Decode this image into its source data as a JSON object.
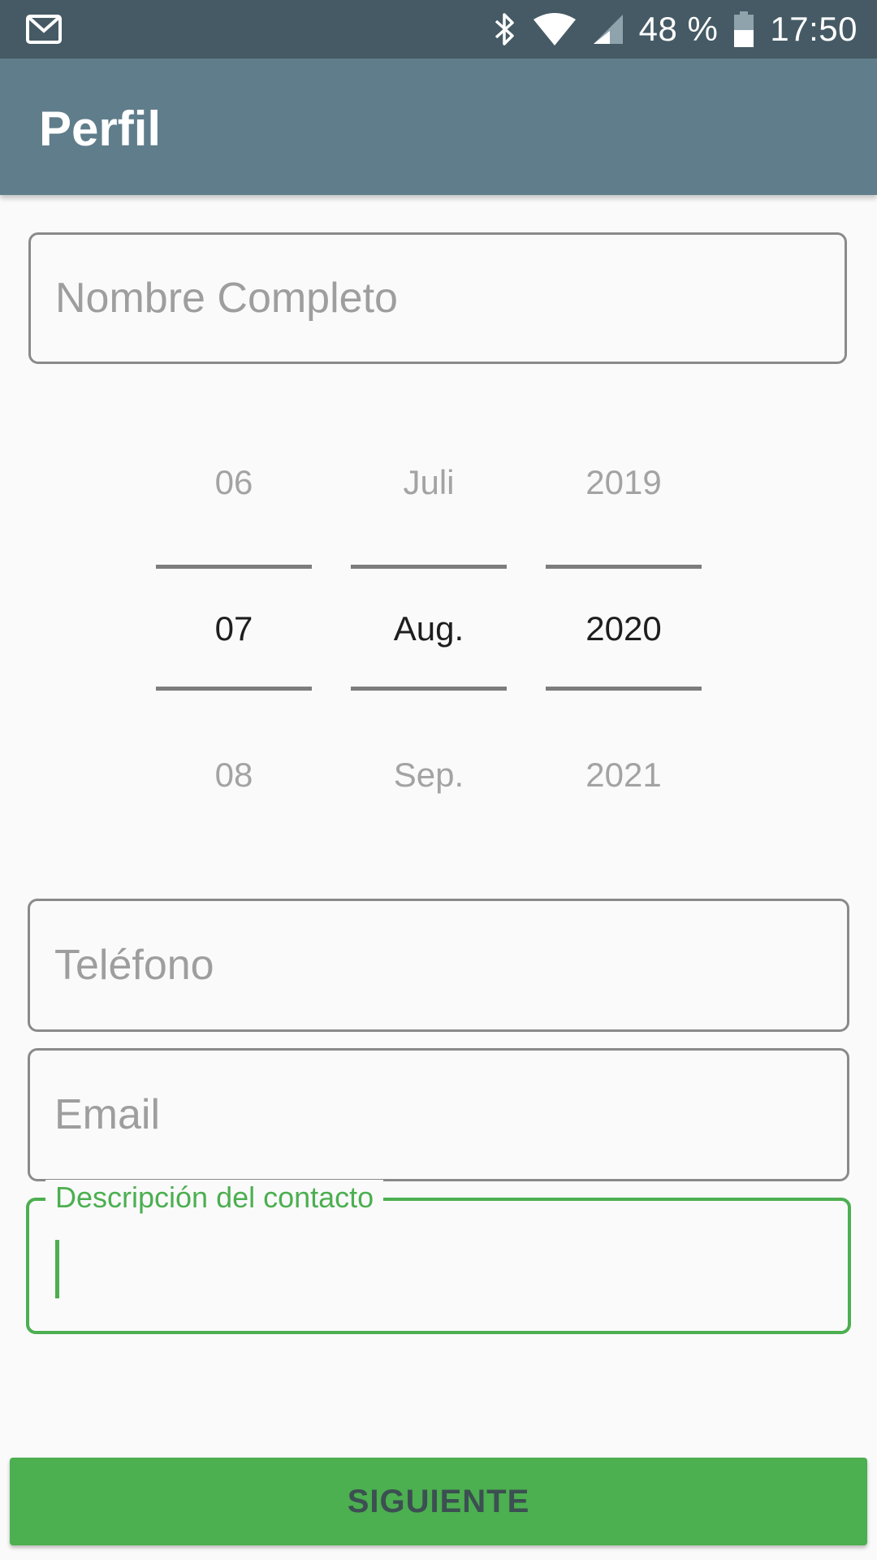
{
  "status_bar": {
    "battery_percent": "48 %",
    "time": "17:50",
    "icons": [
      "gmail-icon",
      "bluetooth-icon",
      "wifi-icon",
      "signal-icon",
      "battery-icon"
    ]
  },
  "app_bar": {
    "title": "Perfil"
  },
  "form": {
    "name_placeholder": "Nombre Completo",
    "phone_placeholder": "Teléfono",
    "email_placeholder": "Email",
    "description_label": "Descripción del contacto"
  },
  "date_picker": {
    "day": {
      "prev": "06",
      "current": "07",
      "next": "08"
    },
    "month": {
      "prev": "Juli",
      "current": "Aug.",
      "next": "Sep."
    },
    "year": {
      "prev": "2019",
      "current": "2020",
      "next": "2021"
    }
  },
  "actions": {
    "next_label": "SIGUIENTE"
  },
  "colors": {
    "status_bar": "#455a64",
    "app_bar": "#607d8b",
    "accent": "#4caf50",
    "background": "#fafafa"
  }
}
